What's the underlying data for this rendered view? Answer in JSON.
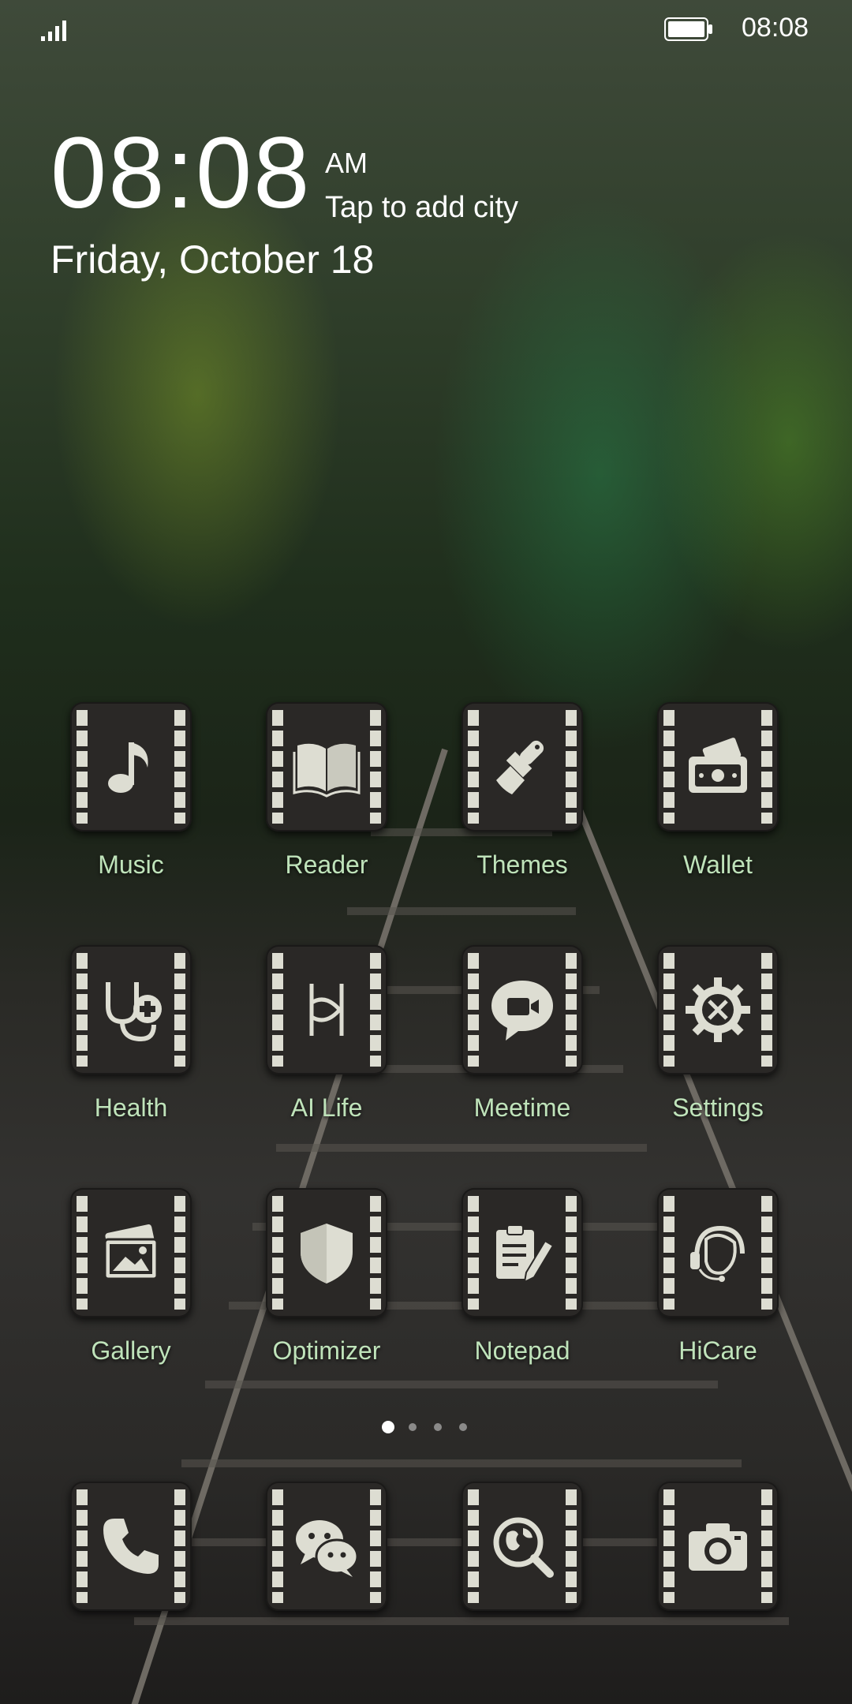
{
  "status_bar": {
    "time": "08:08",
    "signal_icon": "signal-icon",
    "battery_icon": "battery-icon"
  },
  "clock": {
    "time": "08:08",
    "ampm": "AM",
    "city_prompt": "Tap to add city",
    "date": "Friday, October 18"
  },
  "apps": [
    {
      "label": "Music",
      "icon": "music-note-icon"
    },
    {
      "label": "Reader",
      "icon": "book-icon"
    },
    {
      "label": "Themes",
      "icon": "paintbrush-icon"
    },
    {
      "label": "Wallet",
      "icon": "wallet-icon"
    },
    {
      "label": "Health",
      "icon": "stethoscope-icon"
    },
    {
      "label": "AI Life",
      "icon": "ai-life-icon"
    },
    {
      "label": "Meetime",
      "icon": "video-chat-icon"
    },
    {
      "label": "Settings",
      "icon": "gear-icon"
    },
    {
      "label": "Gallery",
      "icon": "gallery-icon"
    },
    {
      "label": "Optimizer",
      "icon": "shield-icon"
    },
    {
      "label": "Notepad",
      "icon": "notepad-icon"
    },
    {
      "label": "HiCare",
      "icon": "headset-icon"
    }
  ],
  "page_indicator": {
    "pages": 4,
    "active_page": 1
  },
  "dock": [
    {
      "icon": "phone-icon"
    },
    {
      "icon": "messages-icon"
    },
    {
      "icon": "browser-icon"
    },
    {
      "icon": "camera-icon"
    }
  ],
  "colors": {
    "label": "#bfe3ba",
    "icon_bg": "#2a2826",
    "icon_fg": "#ddddd2"
  }
}
